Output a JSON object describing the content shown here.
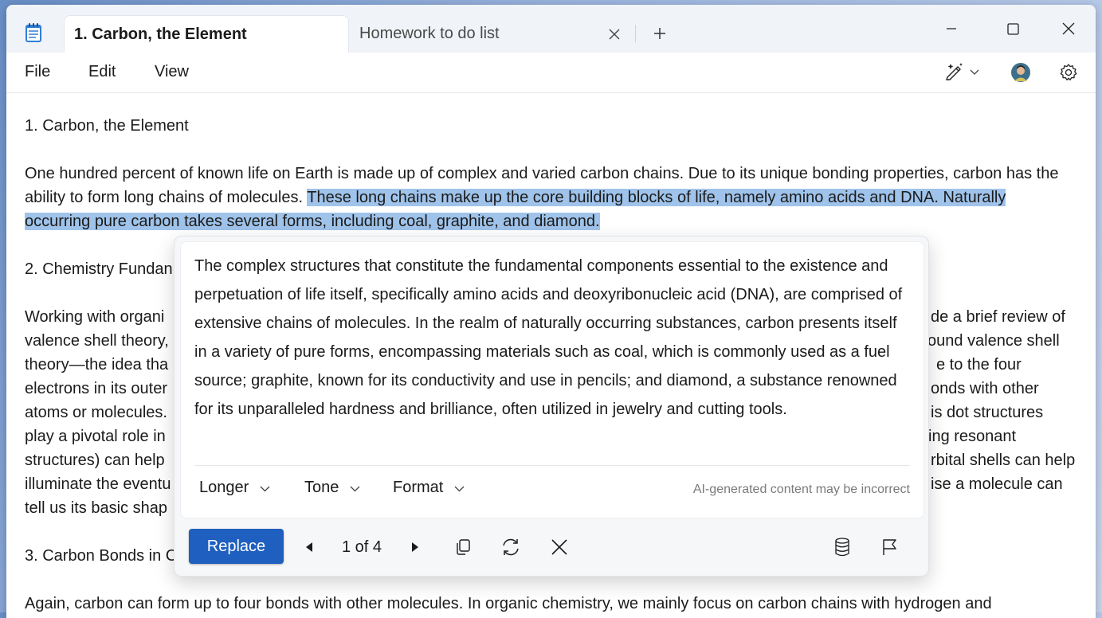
{
  "window": {
    "active_tab": "1. Carbon, the Element",
    "inactive_tab": "Homework to do list"
  },
  "menu": [
    "File",
    "Edit",
    "View"
  ],
  "document": {
    "heading1": "1. Carbon, the Element",
    "p1_before": "One hundred percent of known life on Earth is made up of complex and varied carbon chains. Due to its unique bonding properties, carbon has the ability to form long chains of molecules. ",
    "p1_selected": "These long chains make up the core building blocks of life, namely amino acids and DNA. Naturally occurring pure carbon takes several forms, including coal, graphite, and diamond.",
    "heading2_start": "2. Chemistry Fundan",
    "p2_left": [
      "Working with organi",
      "valence shell theory,",
      "theory—the idea tha",
      "electrons in its outer",
      "atoms or molecules.",
      "play a pivotal role in",
      "structures) can help",
      "illuminate the eventu",
      "tell us its basic shap"
    ],
    "p2_right": [
      "de a brief review of",
      "ound valence shell",
      "e to the four",
      "onds with other",
      "is dot structures",
      "ing resonant",
      "rbital shells can help",
      "ise a molecule can",
      ""
    ],
    "heading3_start": "3. Carbon Bonds in C",
    "p4": "Again, carbon can form up to four bonds with other molecules. In organic chemistry, we mainly focus on carbon chains with hydrogen and"
  },
  "rewrite": {
    "suggestion": "The complex structures that constitute the fundamental components essential to the existence and perpetuation of life itself, specifically amino acids and deoxyribonucleic acid (DNA), are comprised of extensive chains of molecules. In the realm of naturally occurring substances, carbon presents itself in a variety of pure forms, encompassing materials such as coal, which is commonly used as a fuel source; graphite, known for its conductivity and use in pencils; and diamond, a substance renowned for its unparalleled hardness and brilliance, often utilized in jewelry and cutting tools.",
    "option_length": "Longer",
    "option_tone": "Tone",
    "option_format": "Format",
    "disclaimer": "AI-generated content may be incorrect",
    "replace_label": "Replace",
    "counter": "1 of 4"
  },
  "colors": {
    "selection": "#9fc3ea",
    "accent": "#1f5fbf"
  },
  "icons": [
    "notepad-icon",
    "close-icon",
    "plus-icon",
    "minimize-icon",
    "maximize-icon",
    "copilot-pen-icon",
    "chevron-down-icon",
    "avatar",
    "gear-icon",
    "prev-icon",
    "next-icon",
    "copy-icon",
    "regenerate-icon",
    "dismiss-icon",
    "database-icon",
    "flag-icon"
  ]
}
